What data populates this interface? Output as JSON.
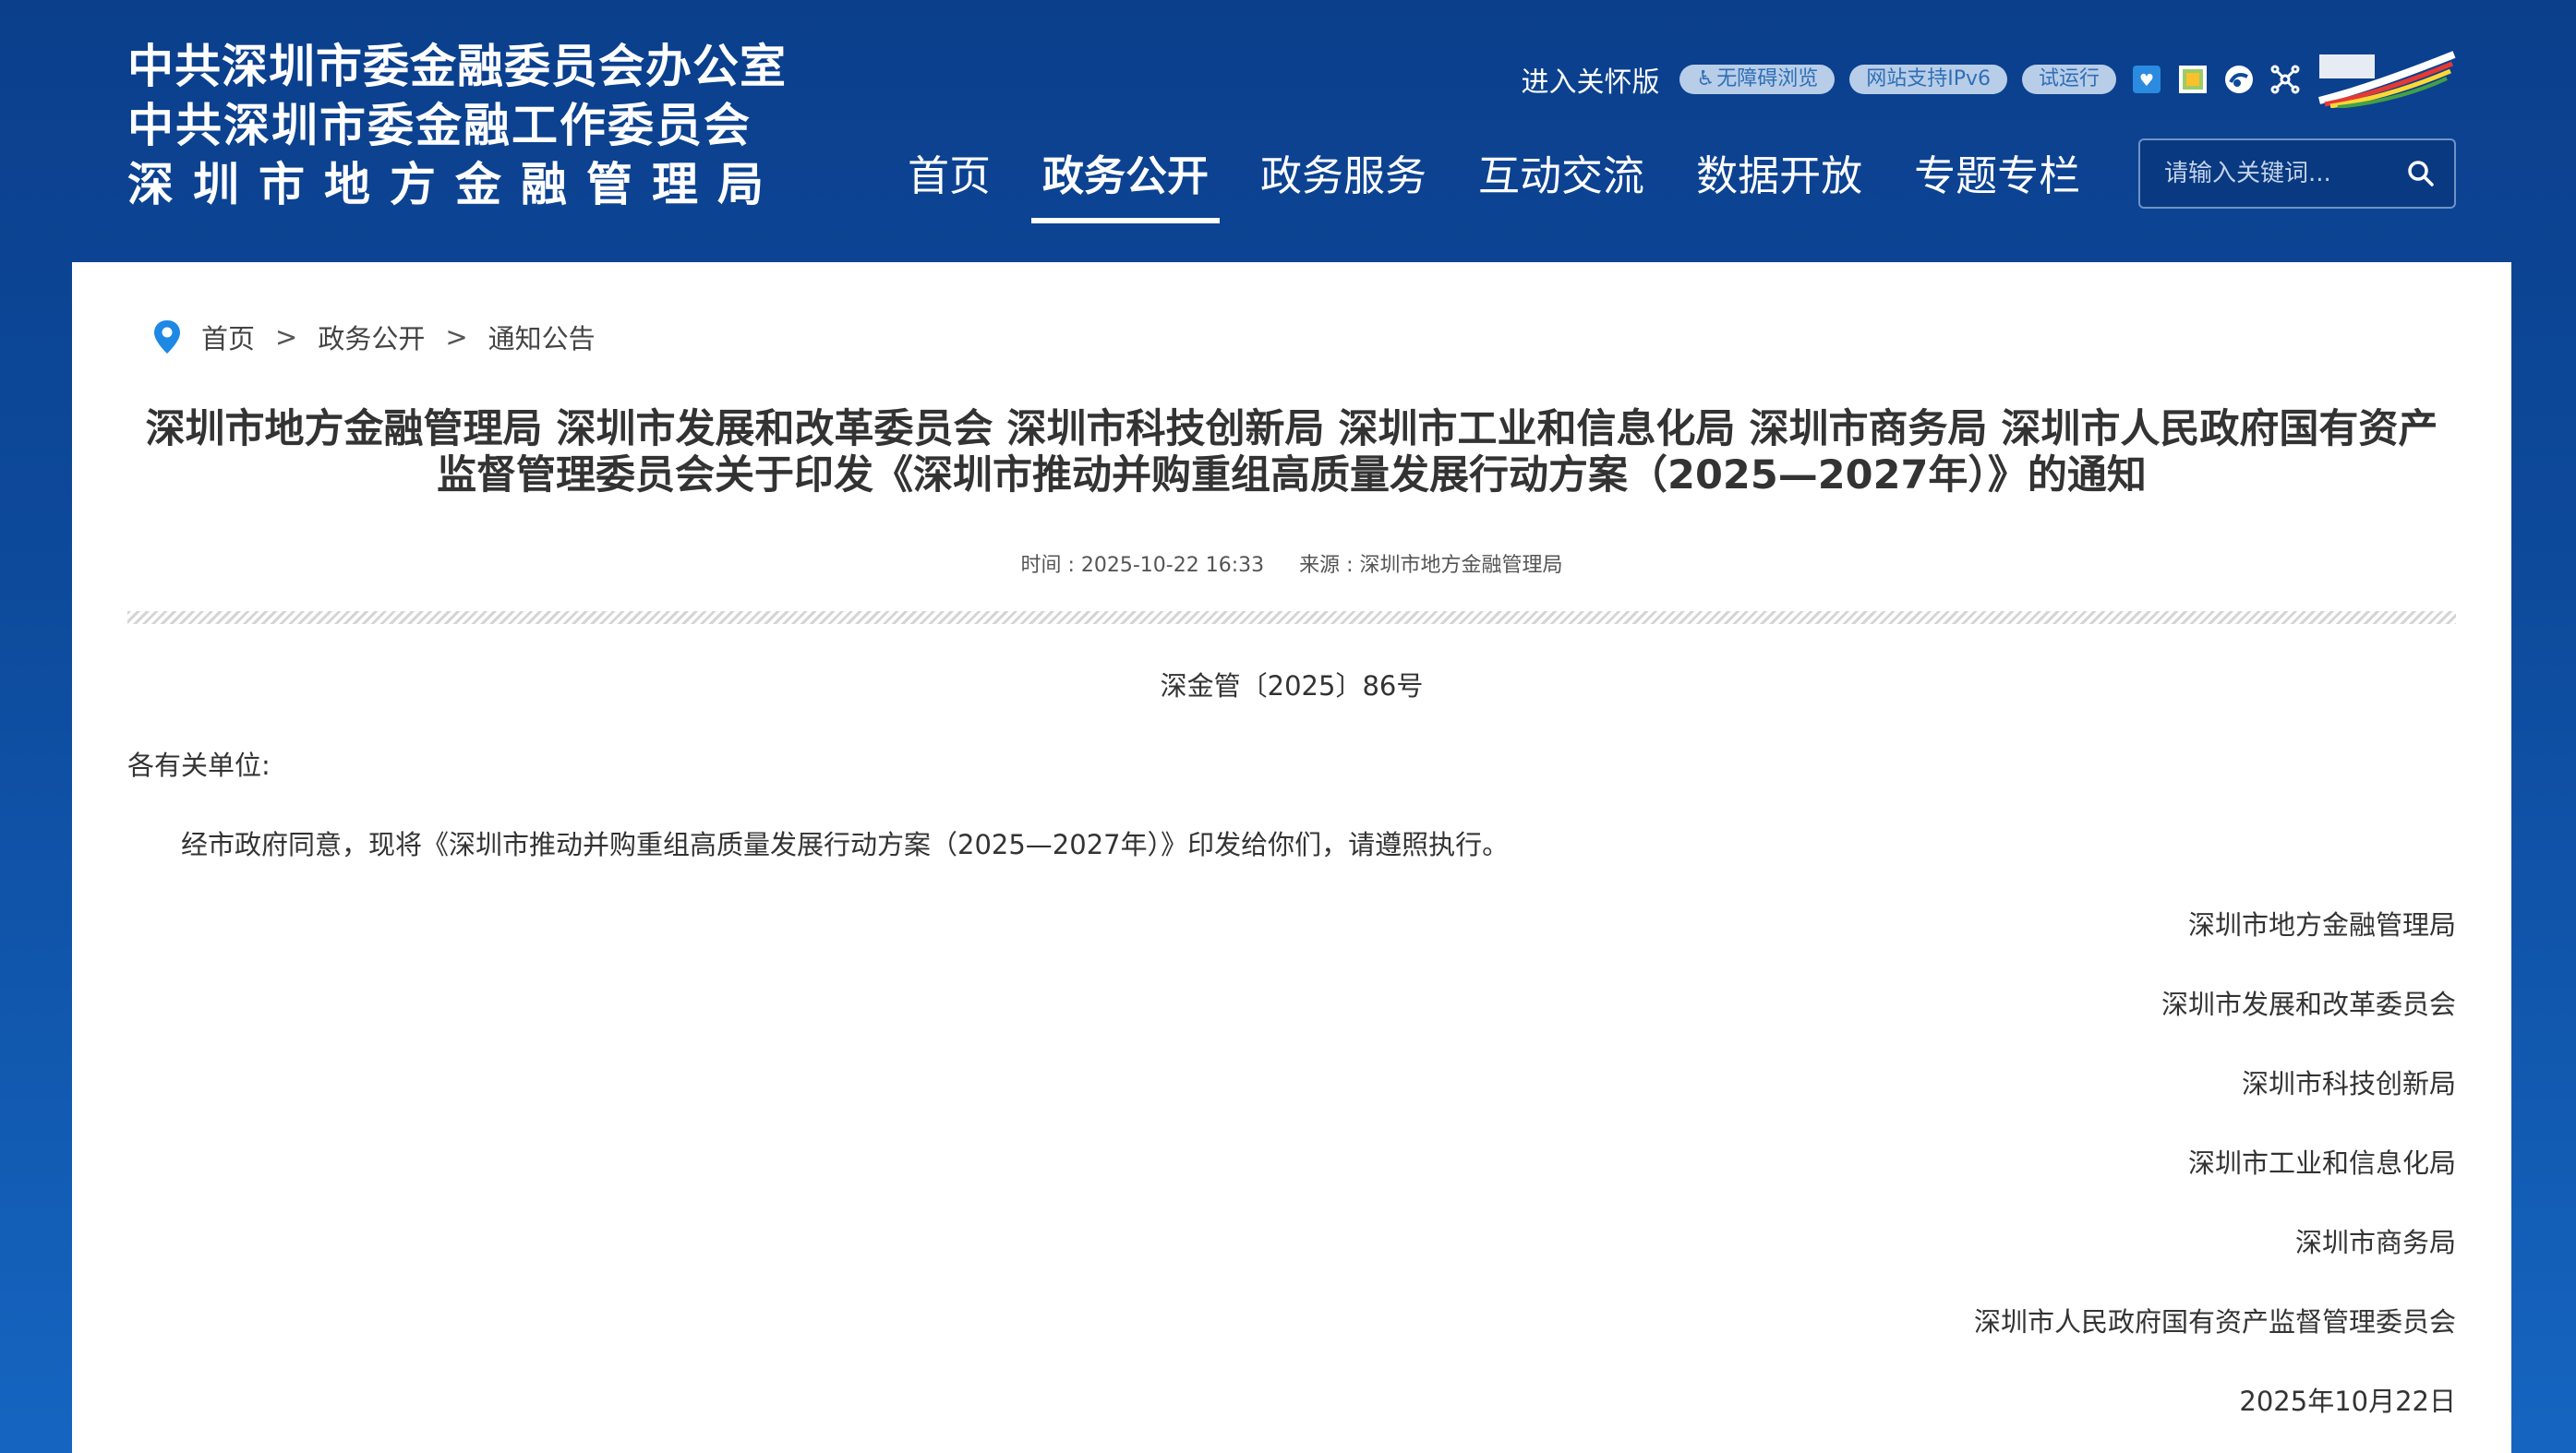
{
  "header": {
    "logo_lines": [
      "中共深圳市委金融委员会办公室",
      "中共深圳市委金融工作委员会",
      "深圳市地方金融管理局"
    ],
    "care_mode": "进入关怀版",
    "pills": [
      "无障碍浏览",
      "网站支持IPv6",
      "试运行"
    ],
    "icons": [
      "elder-care-icon",
      "mobile-site-icon",
      "weibo-icon",
      "network-icon",
      "shenzhen-logo-icon"
    ]
  },
  "nav": {
    "items": [
      "首页",
      "政务公开",
      "政务服务",
      "互动交流",
      "数据开放",
      "专题专栏"
    ],
    "active": "政务公开"
  },
  "search": {
    "placeholder": "请输入关键词..."
  },
  "breadcrumb": [
    "首页",
    "政务公开",
    "通知公告"
  ],
  "article": {
    "title_line1": "深圳市地方金融管理局 深圳市发展和改革委员会 深圳市科技创新局 深圳市工业和信息化局 深圳市商务局 深圳市人民政府国有资产",
    "title_line2": "监督管理委员会关于印发《深圳市推动并购重组高质量发展行动方案（2025—2027年）》的通知",
    "time": "时间 : 2025-10-22 16:33",
    "source": "来源 : 深圳市地方金融管理局",
    "doc_number": "深金管〔2025〕86号",
    "salutation": "各有关单位:",
    "body": "经市政府同意，现将《深圳市推动并购重组高质量发展行动方案（2025—2027年）》印发给你们，请遵照执行。",
    "signatories": [
      "深圳市地方金融管理局",
      "深圳市发展和改革委员会",
      "深圳市科技创新局",
      "深圳市工业和信息化局",
      "深圳市商务局",
      "深圳市人民政府国有资产监督管理委员会"
    ],
    "date": "2025年10月22日"
  },
  "colors": {
    "header_bg": "#0d4a9c",
    "pill_bg": "#b8cde8",
    "pin": "#1e88e5"
  }
}
